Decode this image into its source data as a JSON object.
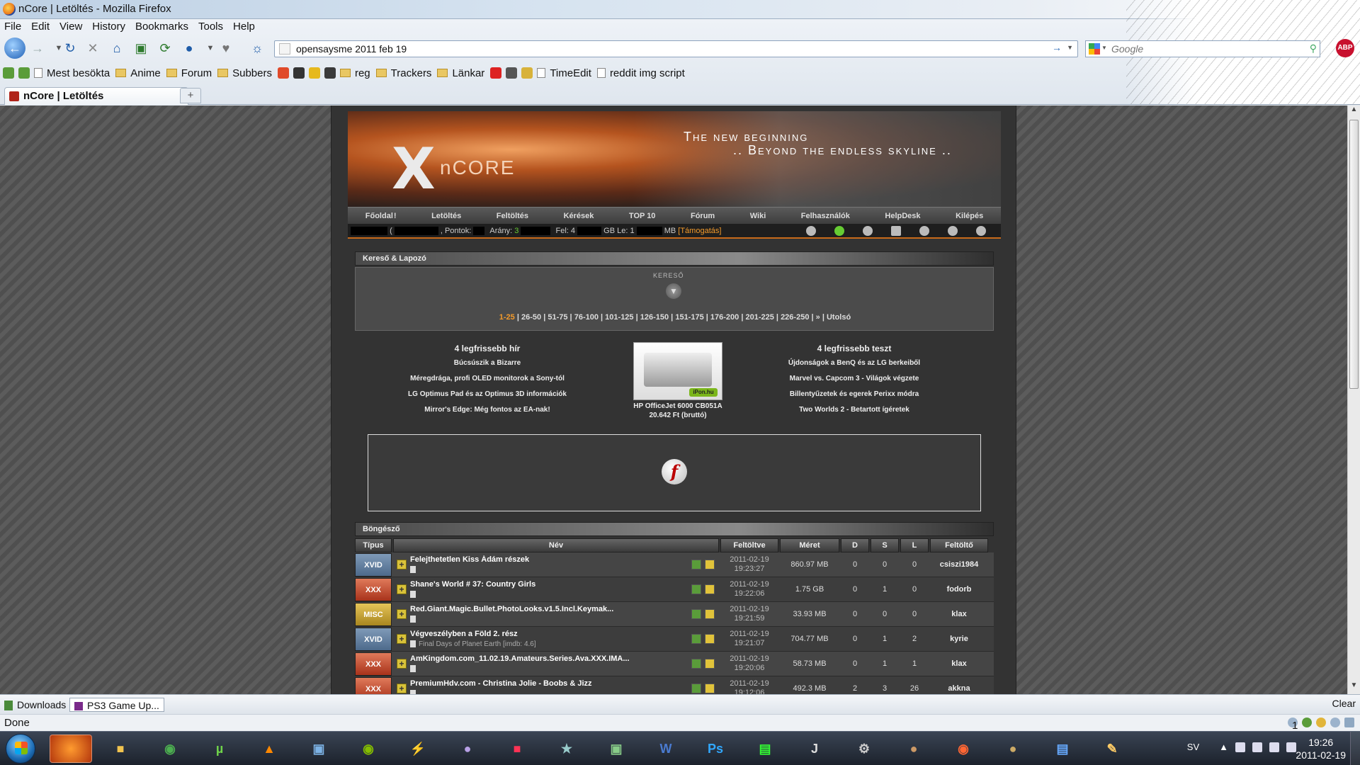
{
  "window": {
    "title": "nCore | Letöltés - Mozilla Firefox"
  },
  "menu": [
    "File",
    "Edit",
    "View",
    "History",
    "Bookmarks",
    "Tools",
    "Help"
  ],
  "address": {
    "value": "opensaysme 2011 feb 19"
  },
  "search": {
    "placeholder": "Google"
  },
  "abp": "ABP",
  "bookmarks": [
    {
      "label": "Mest besökta",
      "icon": "page"
    },
    {
      "label": "Anime",
      "icon": "folder"
    },
    {
      "label": "Forum",
      "icon": "folder"
    },
    {
      "label": "Subbers",
      "icon": "folder"
    },
    {
      "label": "reg",
      "icon": "folder"
    },
    {
      "label": "Trackers",
      "icon": "folder"
    },
    {
      "label": "Länkar",
      "icon": "folder"
    },
    {
      "label": "TimeEdit",
      "icon": "page"
    },
    {
      "label": "reddit img script",
      "icon": "page"
    }
  ],
  "tab": {
    "title": "nCore | Letöltés"
  },
  "site": {
    "logo": "nCORE",
    "slogan1": "The new beginning",
    "slogan2": ".. Beyond the endless skyline ..",
    "nav": [
      "Főoldal",
      "Letöltés",
      "Feltöltés",
      "Kérések",
      "TOP 10",
      "Fórum",
      "Wiki",
      "Felhasználók",
      "HelpDesk",
      "Kilépés"
    ],
    "nav_badge": "!",
    "userbar": {
      "points_label": ", Pontok:",
      "ratio_label": "Arány:",
      "ratio_value": "3",
      "up_label": "Fel: 4",
      "up_unit": "GB",
      "down_label": "Le: 1",
      "down_unit": "MB",
      "support": "[Támogatás]"
    },
    "search_panel": {
      "title": "Kereső & Lapozó",
      "label": "KERESŐ",
      "pages": [
        "1-25",
        "26-50",
        "51-75",
        "76-100",
        "101-125",
        "126-150",
        "151-175",
        "176-200",
        "201-225",
        "226-250",
        "»",
        "Utolsó"
      ]
    },
    "news": {
      "title": "4 legfrissebb hír",
      "items": [
        "Búcsúszik a Bizarre",
        "Méregdrága, profi OLED monitorok a Sony-tól",
        "LG Optimus Pad és az Optimus 3D információk",
        "Mirror's Edge: Még fontos az EA-nak!"
      ]
    },
    "ad": {
      "logo": "iPon.hu",
      "name": "HP OfficeJet 6000 CB051A",
      "price": "20.642 Ft (bruttó)"
    },
    "tests": {
      "title": "4 legfrissebb teszt",
      "items": [
        "Újdonságok a BenQ és az LG berkeiből",
        "Marvel vs. Capcom 3 - Világok végzete",
        "Billentyűzetek és egerek Perixx módra",
        "Two Worlds 2 - Betartott ígéretek"
      ]
    },
    "browser": {
      "title": "Böngésző",
      "columns": [
        "Típus",
        "Név",
        "Feltöltve",
        "Méret",
        "D",
        "S",
        "L",
        "Feltöltő"
      ],
      "rows": [
        {
          "cat": "XVID",
          "cls": "c-xvid",
          "name": "Felejthetetlen Kiss Ádám részek",
          "sub": "",
          "date": "2011-02-19",
          "time": "19:23:27",
          "size": "860.97 MB",
          "d": "0",
          "s": "0",
          "l": "0",
          "uploader": "csiszi1984"
        },
        {
          "cat": "XXX",
          "cls": "c-xxx",
          "name": "Shane's World # 37: Country Girls",
          "sub": "",
          "date": "2011-02-19",
          "time": "19:22:06",
          "size": "1.75 GB",
          "d": "0",
          "s": "1",
          "l": "0",
          "uploader": "fodorb"
        },
        {
          "cat": "MISC",
          "cls": "c-misc",
          "name": "Red.Giant.Magic.Bullet.PhotoLooks.v1.5.Incl.Keymak...",
          "sub": "",
          "date": "2011-02-19",
          "time": "19:21:59",
          "size": "33.93 MB",
          "d": "0",
          "s": "0",
          "l": "0",
          "uploader": "klax"
        },
        {
          "cat": "XVID",
          "cls": "c-xvid",
          "name": "Végveszélyben a Föld 2. rész",
          "sub": "Final Days of Planet Earth [imdb: 4.6]",
          "date": "2011-02-19",
          "time": "19:21:07",
          "size": "704.77 MB",
          "d": "0",
          "s": "1",
          "l": "2",
          "uploader": "kyrie"
        },
        {
          "cat": "XXX",
          "cls": "c-xxx",
          "name": "AmKingdom.com_11.02.19.Amateurs.Series.Ava.XXX.IMA...",
          "sub": "",
          "date": "2011-02-19",
          "time": "19:20:06",
          "size": "58.73 MB",
          "d": "0",
          "s": "1",
          "l": "1",
          "uploader": "klax"
        },
        {
          "cat": "XXX",
          "cls": "c-xxx",
          "name": "PremiumHdv.com - Christina Jolie - Boobs & Jizz",
          "sub": "",
          "date": "2011-02-19",
          "time": "19:12:06",
          "size": "492.3 MB",
          "d": "2",
          "s": "3",
          "l": "26",
          "uploader": "akkna"
        }
      ]
    }
  },
  "downloads": {
    "label": "Downloads",
    "item": "PS3 Game Up...",
    "clear": "Clear"
  },
  "status": {
    "text": "Done",
    "count": "1"
  },
  "taskbar": {
    "lang": "SV",
    "time": "19:26",
    "date": "2011-02-19"
  }
}
